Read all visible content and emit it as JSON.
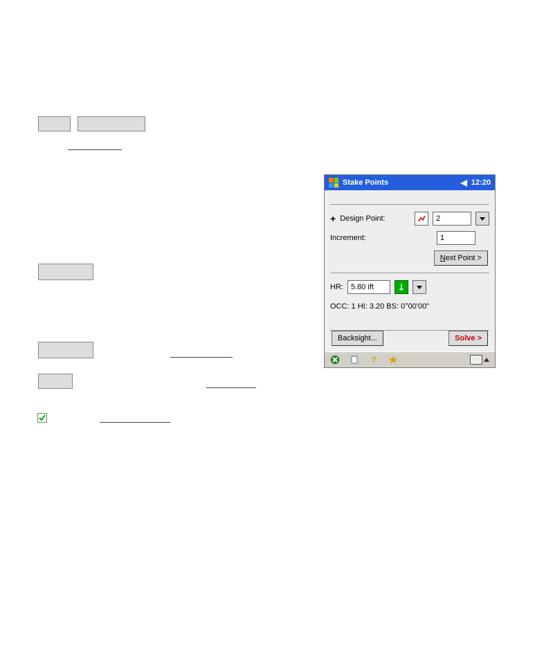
{
  "titlebar": {
    "title": "Stake Points",
    "time": "12:20"
  },
  "main": {
    "design_point_label": "Design Point:",
    "design_point_value": "2",
    "increment_label": "Increment:",
    "increment_value": "1",
    "next_point_u": "N",
    "next_point_rest": "ext Point >",
    "hr_label": "HR:",
    "hr_value": "5.80 ift",
    "status_line": "OCC: 1  HI: 3.20  BS: 0°00'00\""
  },
  "buttons": {
    "backsight": "Backsight...",
    "solve": "Solve >"
  }
}
